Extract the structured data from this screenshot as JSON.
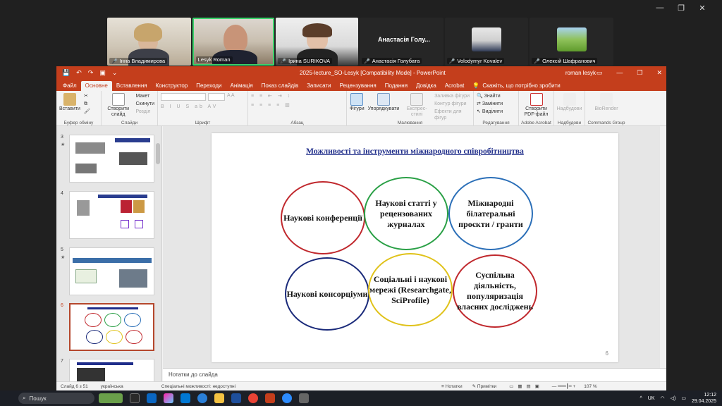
{
  "meeting": {
    "participants": [
      {
        "name": "Інна Владимирова",
        "muted": true
      },
      {
        "name": "Lesyk Roman",
        "muted": false,
        "active_speaker": true
      },
      {
        "name": "Ірина SURIKOVA",
        "muted": true
      },
      {
        "name": "Анастасія Голубата",
        "display_short": "Анастасія Голу...",
        "muted": true
      },
      {
        "name": "Volodymyr Kovalev",
        "muted": true
      },
      {
        "name": "Олексій Шафранович",
        "muted": true
      }
    ]
  },
  "ppt": {
    "doc_title": "2025-lecture_SO-Lesyk [Compatibility Mode] - PowerPoint",
    "user": "roman lesyk",
    "tabs": [
      "Файл",
      "Основне",
      "Вставлення",
      "Конструктор",
      "Переходи",
      "Анімація",
      "Показ слайдів",
      "Записати",
      "Рецензування",
      "Подання",
      "Довідка",
      "Acrobat"
    ],
    "active_tab": "Основне",
    "tell_me": "Скажіть, що потрібно зробити",
    "ribbon": {
      "clipboard": {
        "paste": "Вставити",
        "label": "Буфер обміну"
      },
      "slides": {
        "new_slide": "Створити слайд",
        "layout": "Макет",
        "reset": "Скинути",
        "section": "Розділ",
        "label": "Слайди"
      },
      "font": {
        "label": "Шрифт"
      },
      "paragraph": {
        "label": "Абзац"
      },
      "drawing": {
        "shapes": "Фігури",
        "arrange": "Упорядкувати",
        "quick_styles": "Експрес-стилі",
        "fill": "Заливка фігури",
        "outline": "Контур фігури",
        "effects": "Ефекти для фігур",
        "label": "Малювання"
      },
      "editing": {
        "find": "Знайти",
        "replace": "Замінити",
        "select": "Виділити",
        "label": "Редагування"
      },
      "acrobat": {
        "create_pdf": "Створити PDF-файл",
        "label": "Adobe Acrobat"
      },
      "send": {
        "btn": "Надбудови",
        "label": "Надбудови"
      },
      "commands": {
        "btn": "BioRender",
        "label": "Commands Group"
      }
    },
    "thumbnails": [
      {
        "num": "3",
        "star": "★"
      },
      {
        "num": "4",
        "star": ""
      },
      {
        "num": "5",
        "star": "★"
      },
      {
        "num": "6",
        "star": "",
        "selected": true
      },
      {
        "num": "7",
        "star": ""
      }
    ],
    "slide": {
      "title": "Можливості та інструменти міжнародного співробітництва",
      "number": "6",
      "circles": [
        {
          "text": "Наукові конференції",
          "color": "#c0282d"
        },
        {
          "text": "Наукові статті у рецензованих журналах",
          "color": "#2aa046"
        },
        {
          "text": "Міжнародні білатеральні проєкти / гранти",
          "color": "#2b6fb8"
        },
        {
          "text": "Наукові консорціуми",
          "color": "#1a2a7a"
        },
        {
          "text": "Соціальні і наукові мережі (Researchgate, SciProfile)",
          "color": "#e0c21a"
        },
        {
          "text": "Суспільна діяльність, популяризація власних досліджень",
          "color": "#c0282d"
        }
      ]
    },
    "notes_placeholder": "Нотатки до слайда",
    "status": {
      "slide_of": "Слайд 6 з 51",
      "language": "українська",
      "accessibility": "Спеціальні можливості: недоступні",
      "notes_btn": "Нотатки",
      "comments_btn": "Примітки",
      "zoom": "107 %"
    }
  },
  "taskbar": {
    "search_placeholder": "Пошук",
    "lang": "UK",
    "time": "12:12",
    "date": "29.04.2025"
  }
}
